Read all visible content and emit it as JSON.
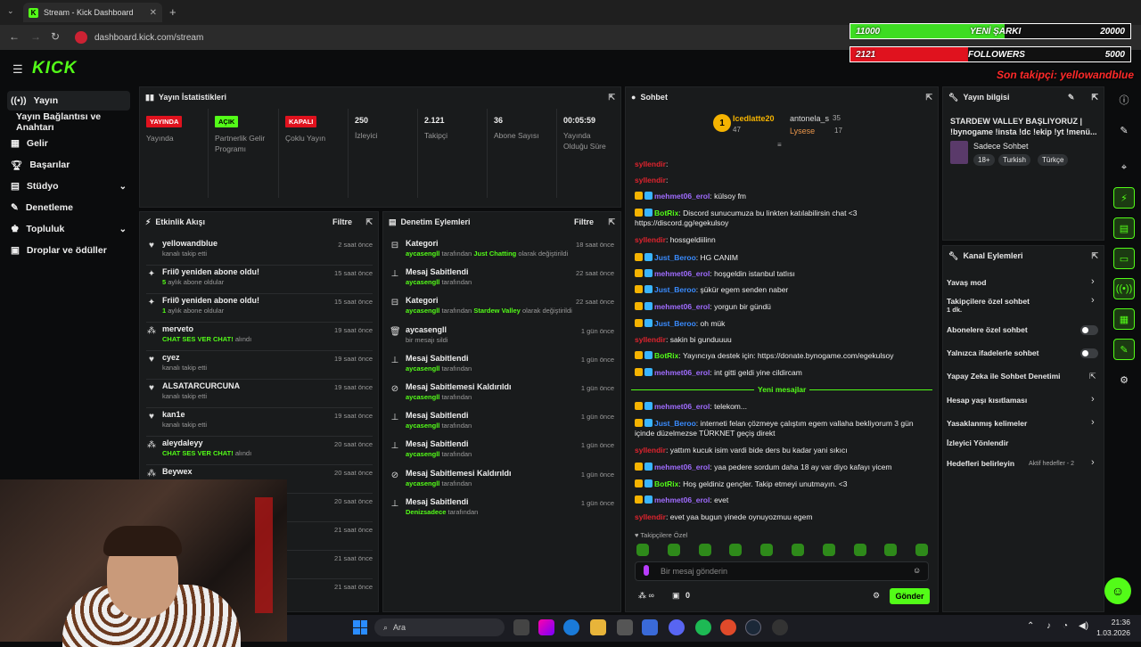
{
  "browser": {
    "tab_title": "Stream - Kick Dashboard",
    "url": "dashboard.kick.com/stream"
  },
  "overlay": {
    "song_left": "11000",
    "song_label": "YENİ ŞARKI",
    "song_right": "20000",
    "song_progress": 0.55,
    "fol_left": "2121",
    "fol_label": "FOLLOWERS",
    "fol_right": "5000",
    "fol_progress": 0.42,
    "son_takipci": "Son takipçi: yellowandblue"
  },
  "logo": "KICK",
  "sidebar": {
    "items": [
      {
        "label": "Yayın"
      },
      {
        "label": "Yayın Bağlantısı ve Anahtarı"
      },
      {
        "label": "Gelir"
      },
      {
        "label": "Başarılar"
      },
      {
        "label": "Stüdyo"
      },
      {
        "label": "Denetleme"
      },
      {
        "label": "Topluluk"
      },
      {
        "label": "Droplar ve ödüller"
      }
    ]
  },
  "stats": {
    "title": "Yayın İstatistikleri",
    "items": [
      {
        "badge": "YAYINDA",
        "label": "Yayında"
      },
      {
        "badge": "AÇIK",
        "label": "Partnerlik Gelir Programı"
      },
      {
        "badge": "KAPALI",
        "label": "Çoklu Yayın"
      },
      {
        "value": "250",
        "label": "İzleyici"
      },
      {
        "value": "2.121",
        "label": "Takipçi"
      },
      {
        "value": "36",
        "label": "Abone Sayısı"
      },
      {
        "value": "00:05:59",
        "label": "Yayında Olduğu Süre"
      }
    ]
  },
  "activity": {
    "title": "Etkinlik Akışı",
    "filter": "Filtre",
    "rows": [
      {
        "name": "yellowandblue",
        "sub": "kanalı takip etti",
        "time": "2 saat önce",
        "icon": "heart"
      },
      {
        "name": "Frii0 yeniden abone oldu!",
        "sub_hl": "5",
        "sub": "aylık abone oldular",
        "time": "15 saat önce",
        "icon": "star"
      },
      {
        "name": "Frii0 yeniden abone oldu!",
        "sub_hl": "1",
        "sub": "aylık abone oldular",
        "time": "15 saat önce",
        "icon": "star"
      },
      {
        "name": "merveto",
        "sub_hl": "CHAT SES VER CHAT!",
        "sub": "alındı",
        "time": "19 saat önce",
        "icon": "dots"
      },
      {
        "name": "cyez",
        "sub": "kanalı takip etti",
        "time": "19 saat önce",
        "icon": "heart"
      },
      {
        "name": "ALSATARCURCUNA",
        "sub": "kanalı takip etti",
        "time": "19 saat önce",
        "icon": "heart"
      },
      {
        "name": "kan1e",
        "sub": "kanalı takip etti",
        "time": "19 saat önce",
        "icon": "heart"
      },
      {
        "name": "aleydaleyy",
        "sub_hl": "CHAT SES VER CHAT!",
        "sub": "alındı",
        "time": "20 saat önce",
        "icon": "dots"
      },
      {
        "name": "Beywex",
        "sub": "",
        "time": "20 saat önce",
        "icon": "dots"
      },
      {
        "name": "",
        "sub": "",
        "time": "20 saat önce",
        "icon": ""
      },
      {
        "name": "",
        "sub": "",
        "time": "21 saat önce",
        "icon": ""
      },
      {
        "name": "",
        "sub": "",
        "time": "21 saat önce",
        "icon": ""
      },
      {
        "name": "",
        "sub": "",
        "time": "21 saat önce",
        "icon": ""
      }
    ]
  },
  "mod": {
    "title": "Denetim Eylemleri",
    "filter": "Filtre",
    "rows": [
      {
        "name": "Kategori",
        "user": "aycasengll",
        "mid": "tarafından",
        "hl": "Just Chatting",
        "tail": "olarak değiştirildi",
        "time": "18 saat önce",
        "icon": "cat"
      },
      {
        "name": "Mesaj Sabitlendi",
        "user": "aycasengll",
        "mid": "tarafından",
        "hl": "",
        "tail": "",
        "time": "22 saat önce",
        "icon": "pin"
      },
      {
        "name": "Kategori",
        "user": "aycasengll",
        "mid": "tarafından",
        "hl": "Stardew Valley",
        "tail": "olarak değiştirildi",
        "time": "22 saat önce",
        "icon": "cat"
      },
      {
        "name": "aycasengll",
        "user": "",
        "mid": "bir mesajı sildi",
        "hl": "",
        "tail": "",
        "time": "1 gün önce",
        "icon": "trash"
      },
      {
        "name": "Mesaj Sabitlendi",
        "user": "aycasengll",
        "mid": "tarafından",
        "hl": "",
        "tail": "",
        "time": "1 gün önce",
        "icon": "pin"
      },
      {
        "name": "Mesaj Sabitlemesi Kaldırıldı",
        "user": "aycasengll",
        "mid": "tarafından",
        "hl": "",
        "tail": "",
        "time": "1 gün önce",
        "icon": "unpin"
      },
      {
        "name": "Mesaj Sabitlendi",
        "user": "aycasengll",
        "mid": "tarafından",
        "hl": "",
        "tail": "",
        "time": "1 gün önce",
        "icon": "pin"
      },
      {
        "name": "Mesaj Sabitlendi",
        "user": "aycasengll",
        "mid": "tarafından",
        "hl": "",
        "tail": "",
        "time": "1 gün önce",
        "icon": "pin"
      },
      {
        "name": "Mesaj Sabitlemesi Kaldırıldı",
        "user": "aycasengll",
        "mid": "tarafından",
        "hl": "",
        "tail": "",
        "time": "1 gün önce",
        "icon": "unpin"
      },
      {
        "name": "Mesaj Sabitlendi",
        "user": "Denizsadece",
        "mid": "tarafından",
        "hl": "",
        "tail": "",
        "time": "1 gün önce",
        "icon": "pin"
      }
    ]
  },
  "chat": {
    "title": "Sohbet",
    "top": [
      {
        "name": "Icedlatte20",
        "score": "47"
      },
      {
        "name": "antonela_s",
        "score": "35"
      },
      {
        "name": "Lysese",
        "score": "17"
      }
    ],
    "lines": [
      {
        "user": "",
        "color": "#e0242e",
        "text": ""
      },
      {
        "user": "syllendir",
        "color": "#e0242e",
        "text": ""
      },
      {
        "user": "syllendir",
        "color": "#e0242e",
        "text": ""
      },
      {
        "user": "mehmet06_erol",
        "color": "#a06cff",
        "text": "külsoy fm"
      },
      {
        "user": "BotRix",
        "color": "#53fc18",
        "text": "Discord sunucumuza bu linkten katılabilirsin chat <3 https://discord.gg/egekulsoy"
      },
      {
        "user": "syllendir",
        "color": "#e0242e",
        "text": "hossgeldiilinn"
      },
      {
        "user": "Just_Beroo",
        "color": "#3a8cff",
        "text": "HG CANIM"
      },
      {
        "user": "mehmet06_erol",
        "color": "#a06cff",
        "text": "hoşgeldin istanbul tatlısı"
      },
      {
        "user": "Just_Beroo",
        "color": "#3a8cff",
        "text": "şükür egem senden naber"
      },
      {
        "user": "mehmet06_erol",
        "color": "#a06cff",
        "text": "yorgun bir gündü"
      },
      {
        "user": "Just_Beroo",
        "color": "#3a8cff",
        "text": "oh mük"
      },
      {
        "user": "syllendir",
        "color": "#e0242e",
        "text": "sakin bi gunduuuu"
      },
      {
        "user": "BotRix",
        "color": "#53fc18",
        "text": "Yayıncıya destek için: https://donate.bynogame.com/egekulsoy"
      },
      {
        "user": "mehmet06_erol",
        "color": "#a06cff",
        "text": "int gitti geldi yine cildircam"
      },
      {
        "user": "mehmet06_erol",
        "color": "#a06cff",
        "text": "telekom..."
      },
      {
        "user": "Just_Beroo",
        "color": "#3a8cff",
        "text": "interneti felan çözmeye çalıştım egem vallaha bekliyorum 3 gün içinde düzelmezse TÜRKNET geçiş direkt"
      },
      {
        "user": "syllendir",
        "color": "#e0242e",
        "text": "yattım kucuk isim vardi bide ders bu kadar yani sıkıcı"
      },
      {
        "user": "mehmet06_erol",
        "color": "#a06cff",
        "text": "yaa pedere sordum daha 18 ay var diyo kafayı yicem"
      },
      {
        "user": "BotRix",
        "color": "#53fc18",
        "text": "Hoş geldiniz gençler. Takip etmeyi unutmayın. <3"
      },
      {
        "user": "mehmet06_erol",
        "color": "#a06cff",
        "text": "evet"
      },
      {
        "user": "syllendir",
        "color": "#e0242e",
        "text": "evet yaa bugun yinede oynuyozmuu egem"
      }
    ],
    "new_messages": "Yeni mesajlar",
    "followers_only": "Takipçilere Özel",
    "placeholder": "Bir mesaj gönderin",
    "send": "Gönder",
    "count_a": "0"
  },
  "info": {
    "title": "Yayın bilgisi",
    "stream_title": "STARDEW VALLEY BAŞLIYORUZ | !bynogame !insta !dc !ekip !yt !menü...",
    "category": "Sadece Sohbet",
    "tags": [
      "18+",
      "Turkish",
      "Türkçe"
    ]
  },
  "channel": {
    "title": "Kanal Eylemleri",
    "items": [
      {
        "label": "Yavaş mod",
        "sub": "",
        "ctrl": "arrow"
      },
      {
        "label": "Takipçilere özel sohbet",
        "sub": "1 dk.",
        "ctrl": "arrow"
      },
      {
        "label": "Abonelere özel sohbet",
        "sub": "",
        "ctrl": "toggle"
      },
      {
        "label": "Yalnızca ifadelerle sohbet",
        "sub": "",
        "ctrl": "toggle"
      },
      {
        "label": "Yapay Zeka ile Sohbet Denetimi",
        "sub": "",
        "ctrl": "ext"
      },
      {
        "label": "Hesap yaşı kısıtlaması",
        "sub": "",
        "ctrl": "arrow"
      },
      {
        "label": "Yasaklanmış kelimeler",
        "sub": "",
        "ctrl": "arrow"
      },
      {
        "label": "İzleyici Yönlendir",
        "sub": "",
        "ctrl": ""
      },
      {
        "label": "Hedefleri belirleyin",
        "sub": "",
        "ctrl": "arrow",
        "extra": "Aktif hedefler - 2"
      }
    ]
  },
  "taskbar": {
    "search": "Ara",
    "time": "21:36",
    "date": "1.03.2026"
  }
}
